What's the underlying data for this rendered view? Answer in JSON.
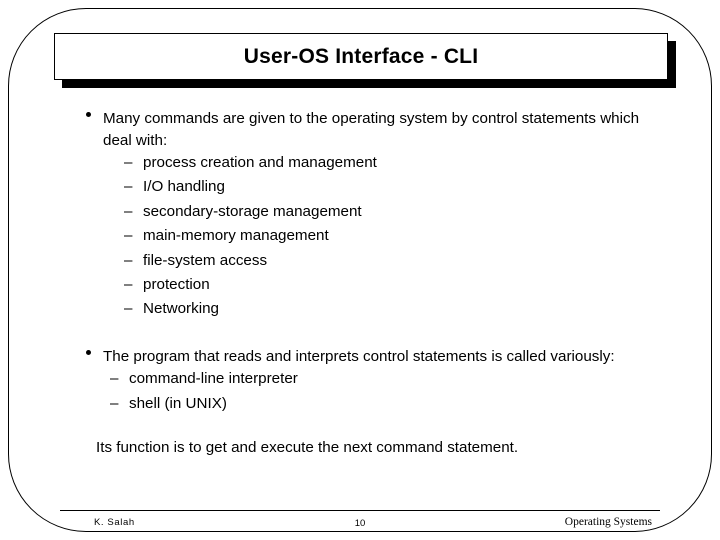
{
  "slide": {
    "title": "User-OS Interface - CLI",
    "bullets": [
      {
        "text": "Many commands are given to the operating system by control statements which deal with:",
        "dash": "–",
        "sub_items": [
          "process creation and management",
          "I/O handling",
          "secondary-storage management",
          "main-memory management",
          "file-system access",
          "protection",
          "Networking"
        ]
      },
      {
        "text": "The program that reads and interprets control statements is called variously:",
        "dash": "–",
        "sub_items": [
          "command-line interpreter",
          "shell (in UNIX)"
        ]
      }
    ],
    "closing_text": "Its function is to get and execute the next command statement."
  },
  "footer": {
    "author": "K. Salah",
    "page_number": "10",
    "course": "Operating Systems"
  },
  "colors": {
    "ink": "#000000",
    "background": "#ffffff"
  }
}
